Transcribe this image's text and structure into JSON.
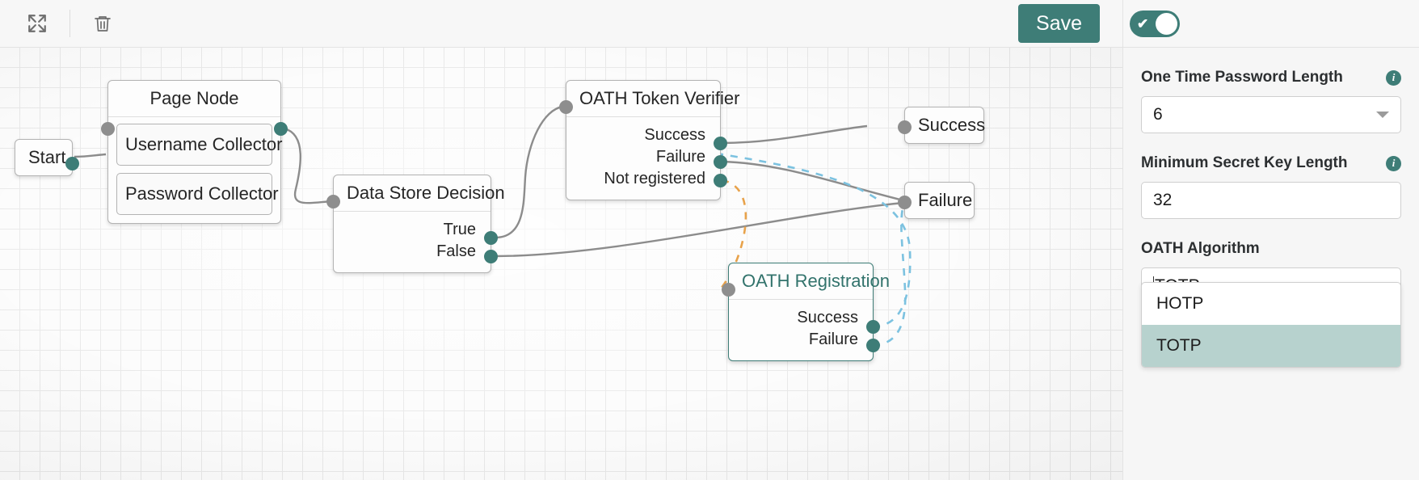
{
  "toolbar": {
    "expand_icon": "expand-arrows-icon",
    "delete_icon": "trash-icon",
    "save_label": "Save"
  },
  "node_toggle": {
    "icon": "check-icon",
    "state": "on"
  },
  "canvas": {
    "nodes": [
      {
        "id": "start",
        "title": "Start"
      },
      {
        "id": "page-node",
        "title": "Page Node",
        "children": [
          "Username Collector",
          "Password Collector"
        ]
      },
      {
        "id": "data-store-decision",
        "title": "Data Store Decision",
        "outputs": [
          "True",
          "False"
        ]
      },
      {
        "id": "oath-token-verifier",
        "title": "OATH Token Verifier",
        "outputs": [
          "Success",
          "Failure",
          "Not registered"
        ]
      },
      {
        "id": "oath-registration",
        "title": "OATH Registration",
        "outputs": [
          "Success",
          "Failure"
        ],
        "selected": true
      },
      {
        "id": "success",
        "title": "Success"
      },
      {
        "id": "failure",
        "title": "Failure"
      }
    ],
    "edge_colors": {
      "solid": "#8c8c8c",
      "dashed_blue": "#7cc2e0",
      "dashed_orange": "#e8a24a"
    }
  },
  "panel": {
    "fields": [
      {
        "id": "one-time-password-length",
        "label": "One Time Password Length",
        "value": "6",
        "type": "select",
        "open": false,
        "info": "info-icon"
      },
      {
        "id": "minimum-secret-key-length",
        "label": "Minimum Secret Key Length",
        "value": "32",
        "type": "text",
        "info": "info-icon"
      },
      {
        "id": "oath-algorithm",
        "label": "OATH Algorithm",
        "value": "TOTP",
        "type": "combobox",
        "open": true,
        "options": [
          "HOTP",
          "TOTP"
        ],
        "selected_option": "TOTP"
      }
    ]
  },
  "colors": {
    "accent": "#3e7d77",
    "accent_light": "#b7d2ce",
    "port_gray": "#8e8e8e",
    "panel_bg": "#f6f6f6"
  }
}
